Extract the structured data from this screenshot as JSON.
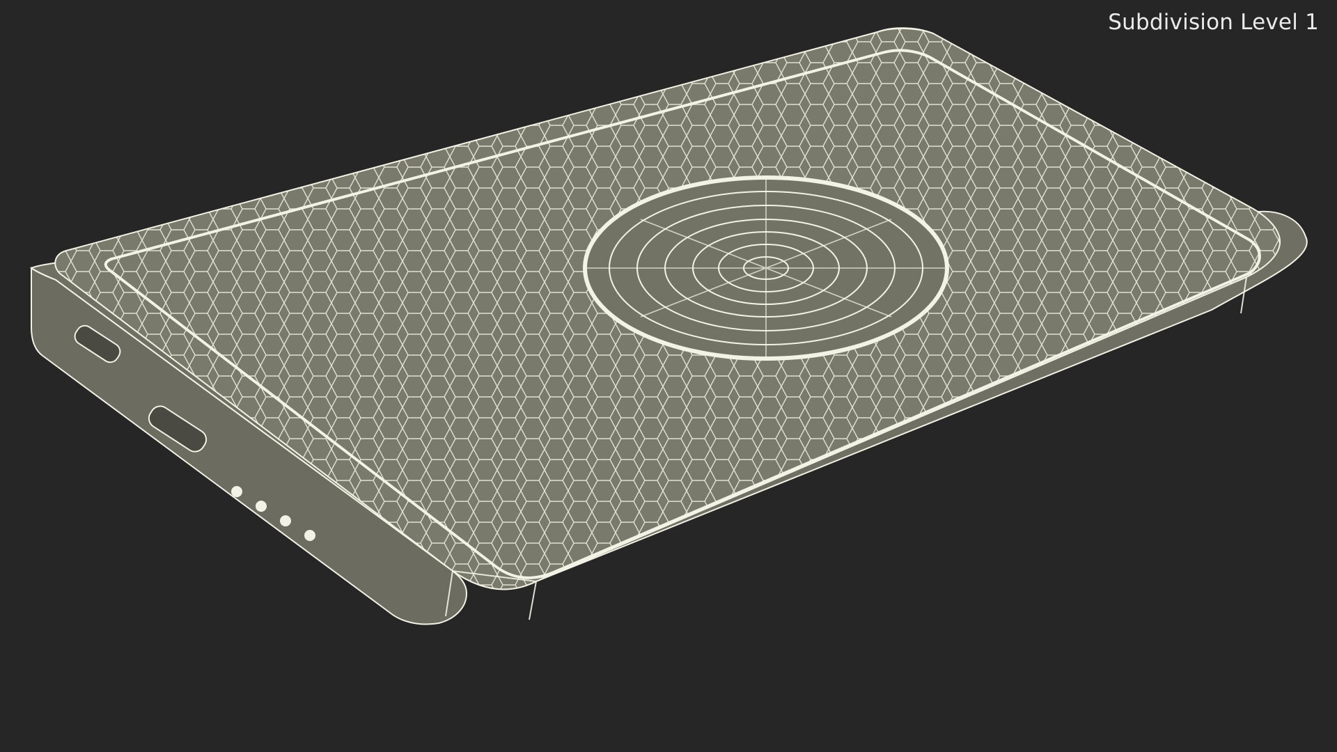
{
  "viewport": {
    "overlay_label": "Subdivision Level 1",
    "background_color": "#262626",
    "wire_color": "#f2f2e6",
    "surface_color": "#7a7a6c"
  },
  "model": {
    "subject": "power-bank",
    "ports": [
      "usb-port",
      "usb-port"
    ],
    "indicator_leds": 4,
    "features": [
      "wireless-charging-pad"
    ]
  }
}
